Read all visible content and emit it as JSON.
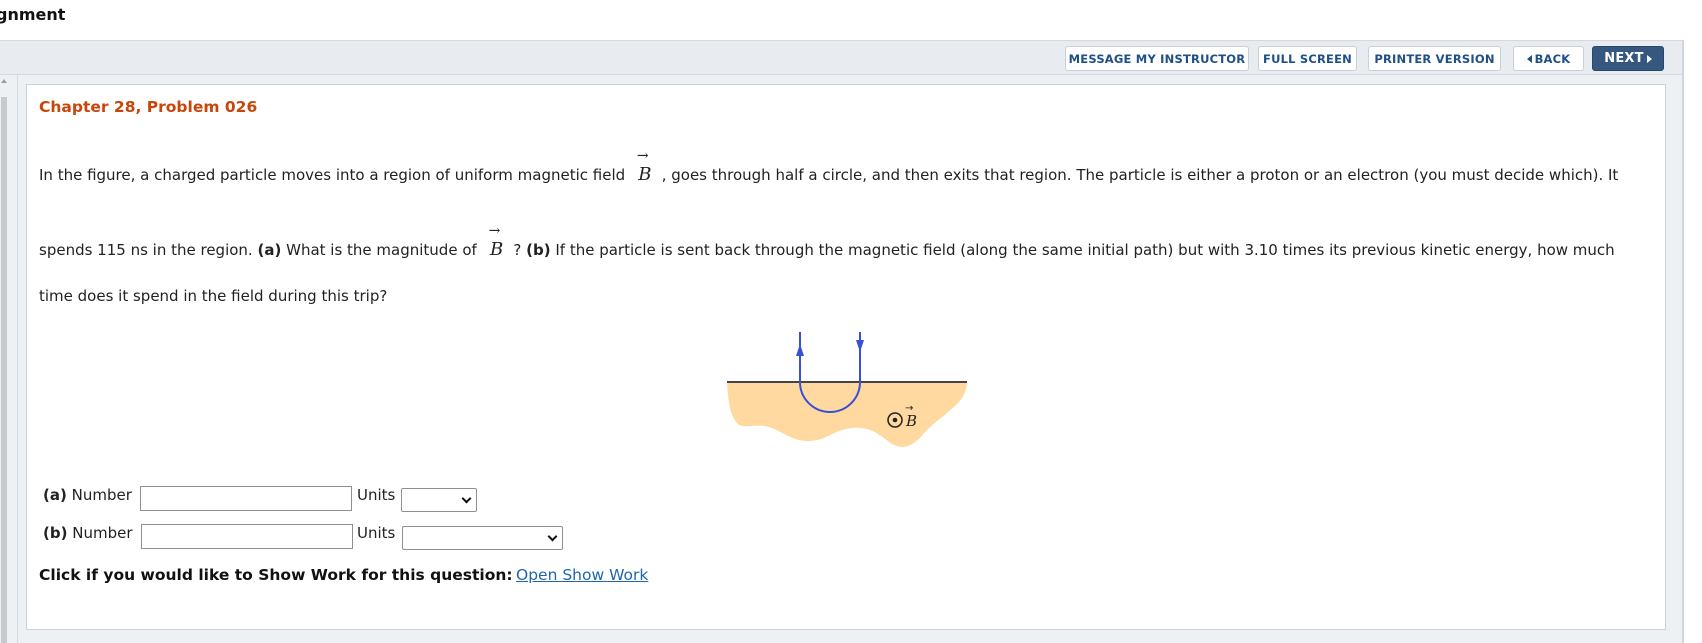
{
  "header": {
    "title": "gnment"
  },
  "toolbar": {
    "message_label": "MESSAGE MY INSTRUCTOR",
    "fullscreen_label": "FULL SCREEN",
    "printer_label": "PRINTER VERSION",
    "back_label": "BACK",
    "next_label": "NEXT"
  },
  "problem": {
    "title": "Chapter 28, Problem 026",
    "line1_pre": "In the figure, a charged particle moves into a region of uniform magnetic field",
    "line1_post": ", goes through half a circle, and then exits that region. The particle is either a proton or an electron (you must decide which). It",
    "line2_pre": "spends 115 ns in the region.",
    "part_a_tag": "(a)",
    "line2_mid": "What is the magnitude of",
    "line2_q": "?",
    "part_b_tag": "(b)",
    "line2_post": "If the particle is sent back through the magnetic field (along the same initial path) but with 3.10 times its previous kinetic energy, how much",
    "line3": "time does it spend in the field during this trip?",
    "vector_symbol": "B",
    "vector_arrow": "→"
  },
  "figure": {
    "field_label": "B",
    "colors": {
      "region": "#ffd9a0",
      "path": "#3a4fd8",
      "boundary": "#444444"
    }
  },
  "answers": {
    "a": {
      "tag": "(a)",
      "number_label": "Number",
      "units_label": "Units",
      "value": ""
    },
    "b": {
      "tag": "(b)",
      "number_label": "Number",
      "units_label": "Units",
      "value": ""
    }
  },
  "show_work": {
    "prompt": "Click if you would like to Show Work for this question:",
    "link": "Open Show Work"
  }
}
